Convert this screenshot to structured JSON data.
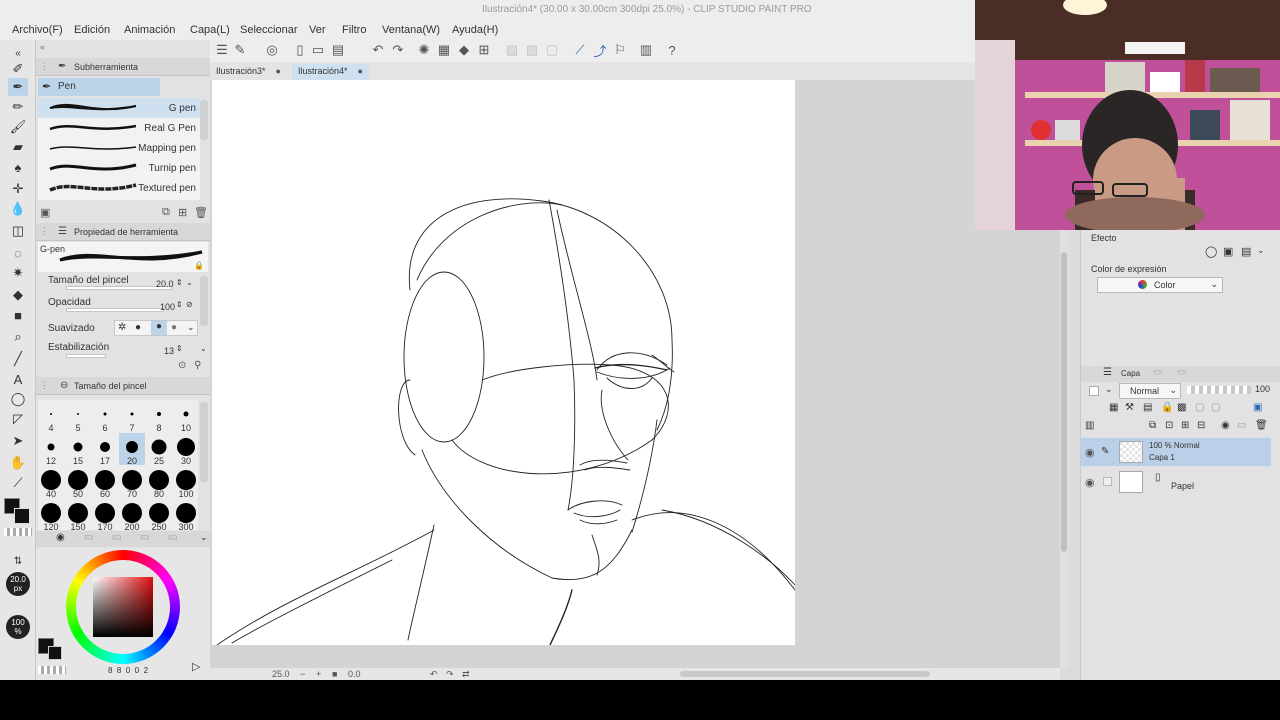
{
  "window": {
    "title": "Ilustración4* (30.00 x 30.00cm 300dpi 25.0%)  - CLIP STUDIO PAINT PRO"
  },
  "menu": [
    "Archivo(F)",
    "Edición",
    "Animación",
    "Capa(L)",
    "Seleccionar",
    "Ver",
    "Filtro",
    "Ventana(W)",
    "Ayuda(H)"
  ],
  "subtool_panel": {
    "title": "Subherramienta",
    "group": "Pen",
    "brushes": [
      "G pen",
      "Real G Pen",
      "Mapping pen",
      "Turnip pen",
      "Textured pen"
    ]
  },
  "tool_property": {
    "title": "Propiedad de herramienta",
    "brush_name": "G-pen",
    "brush_size_label": "Tamaño del pincel",
    "brush_size_value": "20.0",
    "opacity_label": "Opacidad",
    "opacity_value": "100",
    "smoothing_label": "Suavizado",
    "stabilization_label": "Estabilización",
    "stabilization_value": "13"
  },
  "brush_size_panel": {
    "title": "Tamaño del pincel",
    "sizes": [
      "4",
      "5",
      "6",
      "7",
      "8",
      "10",
      "12",
      "15",
      "17",
      "20",
      "25",
      "30",
      "40",
      "50",
      "60",
      "70",
      "80",
      "100",
      "120",
      "150",
      "170",
      "200",
      "250",
      "300"
    ],
    "selected": "20"
  },
  "indicators": {
    "size": "20.0",
    "size_unit": "px",
    "opacity": "100",
    "opacity_unit": "%"
  },
  "color_readout": "8  8  0  0  2",
  "tabs": [
    {
      "label": "Ilustración3*"
    },
    {
      "label": "Ilustración4*"
    }
  ],
  "status": {
    "zoom": "25.0",
    "rotation": "0.0"
  },
  "right_panel": {
    "effect_label": "Efecto",
    "expression_color_label": "Color de expresión",
    "expression_color_value": "Color",
    "layer_tab": "Capa",
    "blend_mode": "Normal",
    "opacity": "100",
    "layers": [
      {
        "line1": "100 % Normal",
        "line2": "Capa 1"
      },
      {
        "line1": "",
        "line2": "Papel"
      }
    ]
  },
  "colors": {
    "accent": "#bcd4ea",
    "panel": "#e2e2e2",
    "canvas": "#ffffff"
  }
}
